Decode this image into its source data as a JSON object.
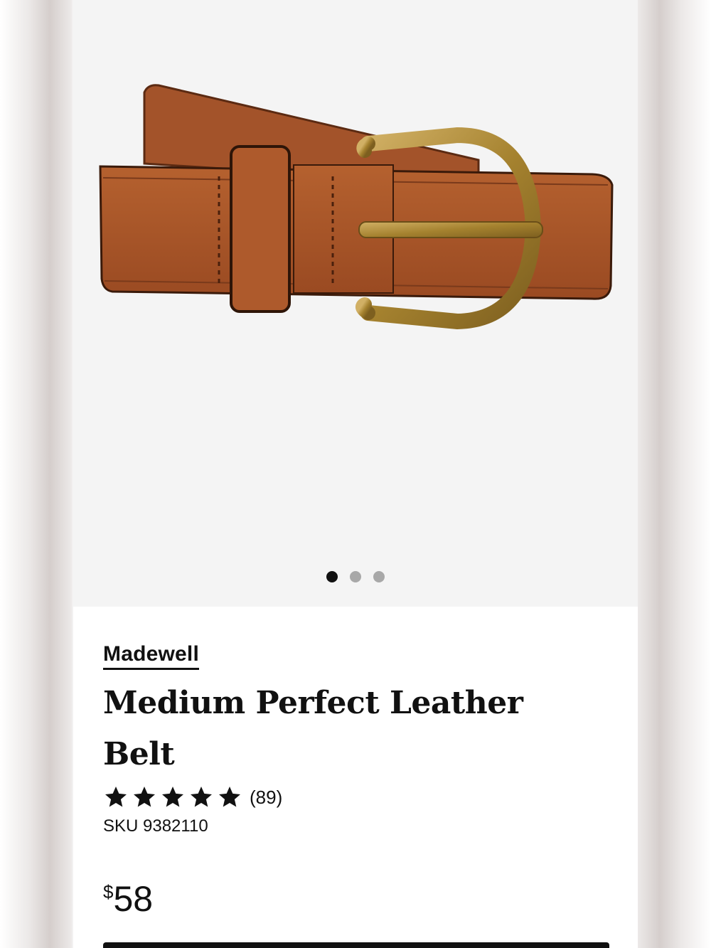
{
  "product": {
    "brand": "Madewell",
    "title": "Medium Perfect Leather Belt",
    "rating": 5,
    "rating_count": "(89)",
    "sku": "SKU 9382110",
    "price_currency": "$",
    "price_amount": "58"
  },
  "gallery": {
    "image_count": 3,
    "active_index": 0,
    "image_alt": "Brown leather belt with brass buckle"
  },
  "colors": {
    "leather": "#a8532c",
    "leather_dark": "#7a3a1b",
    "brass": "#b08a3a",
    "active_dot": "#111111",
    "inactive_dot": "#a8a8a8"
  },
  "icons": [
    "star-icon"
  ]
}
